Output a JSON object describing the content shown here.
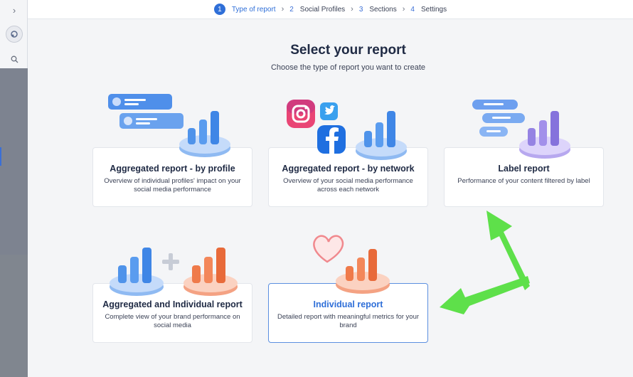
{
  "stepper": {
    "steps": [
      {
        "num": "1",
        "label": "Type of report"
      },
      {
        "num": "2",
        "label": "Social Profiles"
      },
      {
        "num": "3",
        "label": "Sections"
      },
      {
        "num": "4",
        "label": "Settings"
      }
    ],
    "active_index": 0
  },
  "header": {
    "title": "Select your report",
    "subtitle": "Choose the type of report you want to create"
  },
  "cards": [
    {
      "title": "Aggregated report - by profile",
      "desc": "Overview of individual profiles' impact on your social media performance",
      "selected": false
    },
    {
      "title": "Aggregated report - by network",
      "desc": "Overview of your social media performance across each network",
      "selected": false
    },
    {
      "title": "Label report",
      "desc": "Performance of your content filtered by label",
      "selected": false
    },
    {
      "title": "Aggregated and Individual report",
      "desc": "Complete view of your brand performance on social media",
      "selected": false
    },
    {
      "title": "Individual report",
      "desc": "Detailed report with meaningful metrics for your brand",
      "selected": true
    }
  ],
  "colors": {
    "accent": "#2f6fd8",
    "annotation_arrow": "#5ee04a",
    "blue_bars": "#4f93ea",
    "purple_bars": "#8f7ae0",
    "orange_bars": "#ef7a4a"
  },
  "icons": [
    "chevron-right-icon",
    "app-logo-icon",
    "search-icon",
    "instagram-icon",
    "twitter-icon",
    "facebook-icon",
    "heart-icon",
    "plus-icon"
  ]
}
